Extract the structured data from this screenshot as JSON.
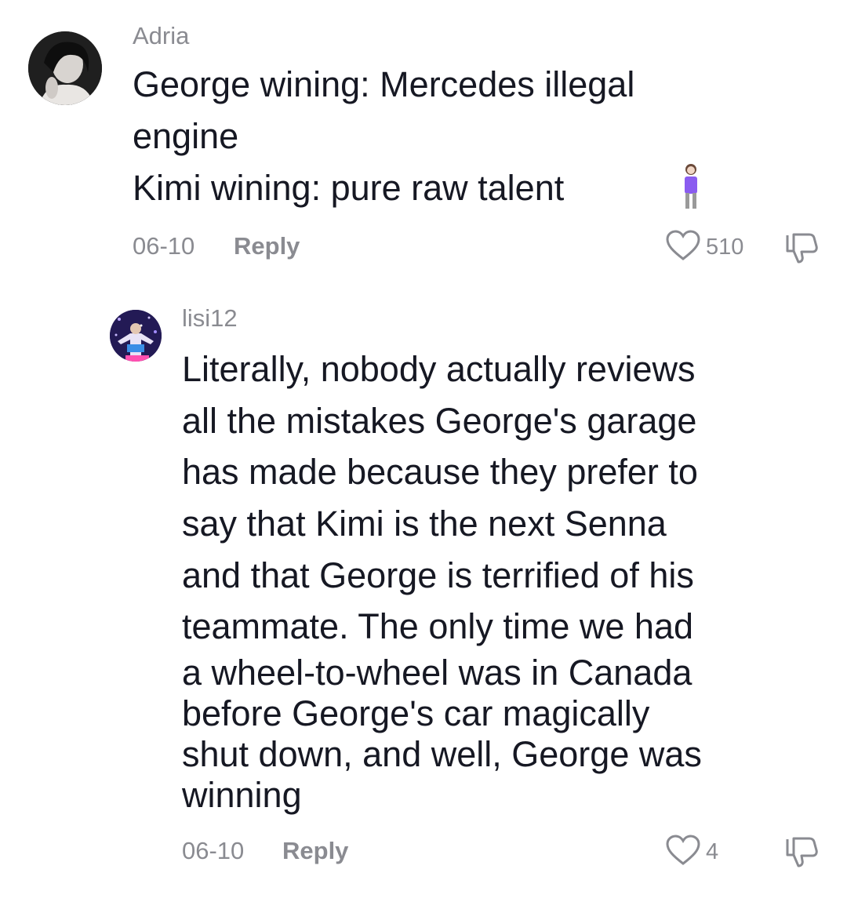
{
  "comments": [
    {
      "username": "Adria",
      "lines": [
        "George wining: Mercedes illegal",
        "engine",
        "Kimi wining: pure raw talent"
      ],
      "emoji": "woman-standing-icon",
      "date": "06-10",
      "reply_label": "Reply",
      "like_count": "510"
    },
    {
      "username": "lisi12",
      "lines": [
        "Literally, nobody actually reviews",
        "all the mistakes George's garage",
        "has made because they prefer to",
        "say that Kimi is the next Senna",
        "and that George is terrified of his",
        "teammate. The only time we had",
        "a wheel-to-wheel was in Canada",
        "before George's car magically",
        "shut down, and well, George was",
        "winning"
      ],
      "date": "06-10",
      "reply_label": "Reply",
      "like_count": "4"
    }
  ],
  "colors": {
    "text": "#161823",
    "muted": "#8a8b91",
    "background": "#ffffff"
  },
  "icons": [
    "heart-outline-icon",
    "thumbs-down-icon"
  ]
}
